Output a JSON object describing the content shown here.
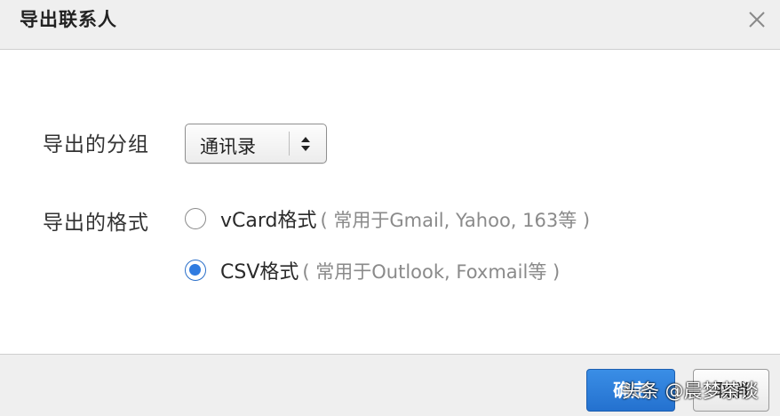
{
  "dialog": {
    "title": "导出联系人",
    "close_icon": "close-icon"
  },
  "group_row": {
    "label": "导出的分组",
    "select_value": "通讯录",
    "select_icon": "up-down-arrows-icon"
  },
  "format_row": {
    "label": "导出的格式",
    "options": [
      {
        "name": "vCard格式",
        "hint": "( 常用于Gmail, Yahoo, 163等 )",
        "selected": false
      },
      {
        "name": "CSV格式",
        "hint": "( 常用于Outlook, Foxmail等 )",
        "selected": true
      }
    ]
  },
  "footer": {
    "confirm_label": "确定",
    "cancel_label": "取消"
  },
  "watermark": "头条 @晨梦茶谈",
  "colors": {
    "accent": "#2f7be0",
    "titlebar_bg": "#efefef"
  }
}
